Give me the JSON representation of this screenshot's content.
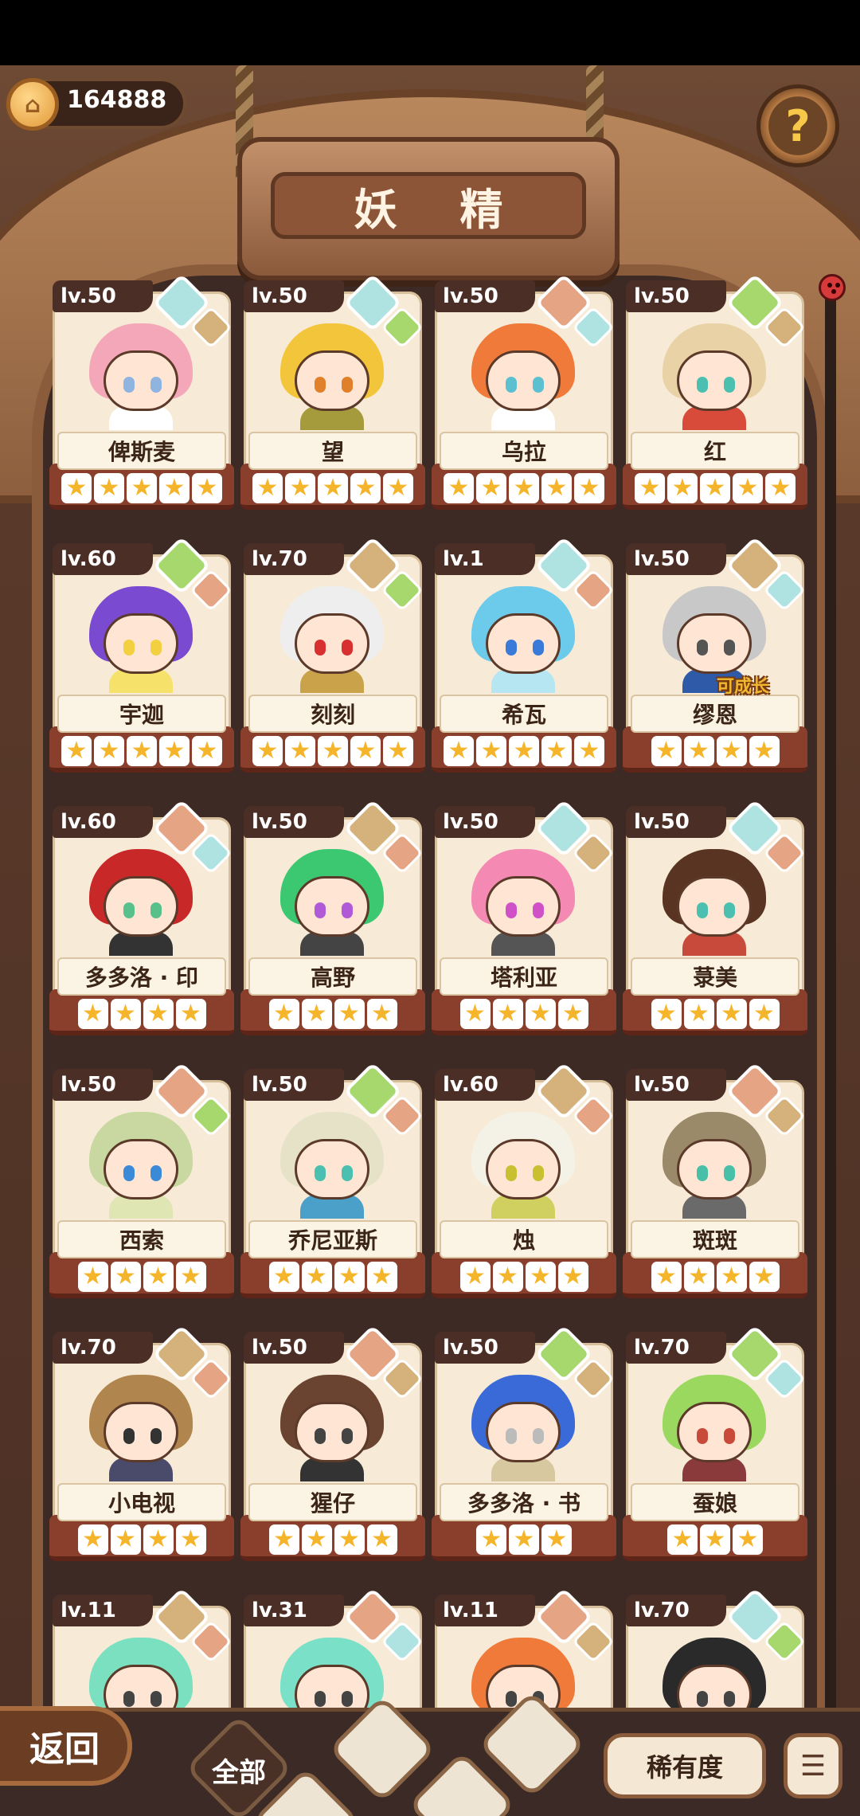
{
  "header": {
    "title": "妖 精",
    "currency": "164888",
    "help_label": "?"
  },
  "cards": [
    {
      "level": "lv.50",
      "name": "俾斯麦",
      "stars": 5,
      "el1": "water",
      "el2": "earth",
      "hair": "#f4a7b8",
      "eye": "#8fb4e0",
      "outfit": "#ffffff"
    },
    {
      "level": "lv.50",
      "name": "望",
      "stars": 5,
      "el1": "water",
      "el2": "plant",
      "hair": "#f3c53b",
      "eye": "#e0802a",
      "outfit": "#a59a3c"
    },
    {
      "level": "lv.50",
      "name": "乌拉",
      "stars": 5,
      "el1": "fire",
      "el2": "water",
      "hair": "#f07a3a",
      "eye": "#5cc0d0",
      "outfit": "#ffffff"
    },
    {
      "level": "lv.50",
      "name": "红",
      "stars": 5,
      "el1": "plant",
      "el2": "earth",
      "hair": "#e8d2a6",
      "eye": "#4cc0b0",
      "outfit": "#d84a3a"
    },
    {
      "level": "lv.60",
      "name": "宇迦",
      "stars": 5,
      "el1": "plant",
      "el2": "fire",
      "hair": "#7a4ad0",
      "eye": "#f2d040",
      "outfit": "#f6e26a"
    },
    {
      "level": "lv.70",
      "name": "刻刻",
      "stars": 5,
      "el1": "earth",
      "el2": "plant",
      "hair": "#eeeeee",
      "eye": "#d83030",
      "outfit": "#c9a24a"
    },
    {
      "level": "lv.1",
      "name": "希瓦",
      "stars": 5,
      "el1": "water",
      "el2": "fire",
      "hair": "#6ccaea",
      "eye": "#3a7ad8",
      "outfit": "#b6e6f2"
    },
    {
      "level": "lv.50",
      "name": "缪恩",
      "stars": 4,
      "el1": "earth",
      "el2": "water",
      "hair": "#c8c8c8",
      "eye": "#555555",
      "outfit": "#2f5aa8",
      "tag": "可成长"
    },
    {
      "level": "lv.60",
      "name": "多多洛 · 印",
      "stars": 4,
      "el1": "fire",
      "el2": "water",
      "hair": "#c82828",
      "eye": "#58c08a",
      "outfit": "#333333"
    },
    {
      "level": "lv.50",
      "name": "高野",
      "stars": 4,
      "el1": "earth",
      "el2": "fire",
      "hair": "#3cc870",
      "eye": "#b05ad8",
      "outfit": "#444444"
    },
    {
      "level": "lv.50",
      "name": "塔利亚",
      "stars": 4,
      "el1": "water",
      "el2": "earth",
      "hair": "#f48ab4",
      "eye": "#d050c8",
      "outfit": "#555555"
    },
    {
      "level": "lv.50",
      "name": "菉美",
      "stars": 4,
      "el1": "water",
      "el2": "fire",
      "hair": "#5a3422",
      "eye": "#4cc0b0",
      "outfit": "#c84a3a"
    },
    {
      "level": "lv.50",
      "name": "西索",
      "stars": 4,
      "el1": "fire",
      "el2": "plant",
      "hair": "#c8d8a0",
      "eye": "#3a8ad8",
      "outfit": "#dfe6b4"
    },
    {
      "level": "lv.50",
      "name": "乔尼亚斯",
      "stars": 4,
      "el1": "plant",
      "el2": "fire",
      "hair": "#e6e2c8",
      "eye": "#4cc0b0",
      "outfit": "#4aa0c8"
    },
    {
      "level": "lv.60",
      "name": "烛",
      "stars": 4,
      "el1": "earth",
      "el2": "fire",
      "hair": "#f4f2e6",
      "eye": "#c8c030",
      "outfit": "#d0d060"
    },
    {
      "level": "lv.50",
      "name": "斑斑",
      "stars": 4,
      "el1": "fire",
      "el2": "earth",
      "hair": "#9a8a6a",
      "eye": "#48c0a8",
      "outfit": "#6a6a6a"
    },
    {
      "level": "lv.70",
      "name": "小电视",
      "stars": 4,
      "el1": "earth",
      "el2": "fire",
      "hair": "#b0864e",
      "eye": "#333333",
      "outfit": "#4a4a6a"
    },
    {
      "level": "lv.50",
      "name": "猩仔",
      "stars": 4,
      "el1": "fire",
      "el2": "earth",
      "hair": "#6a4430",
      "eye": "#444444",
      "outfit": "#333333"
    },
    {
      "level": "lv.50",
      "name": "多多洛 · 书",
      "stars": 3,
      "el1": "plant",
      "el2": "earth",
      "hair": "#3a6ad8",
      "eye": "#bbbbbb",
      "outfit": "#d8c8a0"
    },
    {
      "level": "lv.70",
      "name": "蚕娘",
      "stars": 3,
      "el1": "plant",
      "el2": "water",
      "hair": "#9ad860",
      "eye": "#c84a3a",
      "outfit": "#8a3a3a"
    },
    {
      "level": "lv.11",
      "name": "",
      "stars": 0,
      "el1": "earth",
      "el2": "fire",
      "hair": "#7ae0c0",
      "eye": "#444444",
      "outfit": "#ffffff"
    },
    {
      "level": "lv.31",
      "name": "",
      "stars": 0,
      "el1": "fire",
      "el2": "water",
      "hair": "#7ae0c8",
      "eye": "#444444",
      "outfit": "#ffffff"
    },
    {
      "level": "lv.11",
      "name": "",
      "stars": 0,
      "el1": "fire",
      "el2": "earth",
      "hair": "#f07a3a",
      "eye": "#444444",
      "outfit": "#ffffff"
    },
    {
      "level": "lv.70",
      "name": "",
      "stars": 0,
      "el1": "water",
      "el2": "plant",
      "hair": "#2a2a2a",
      "eye": "#444444",
      "outfit": "#ffffff"
    }
  ],
  "bottom": {
    "back_label": "返回",
    "filter_all_label": "全部",
    "sort_label": "稀有度",
    "order_icon": "sort-descending-icon"
  },
  "element_colors": {
    "water": "#aee3e2",
    "plant": "#a6d86e",
    "earth": "#d5b27c",
    "fire": "#e5a584"
  }
}
